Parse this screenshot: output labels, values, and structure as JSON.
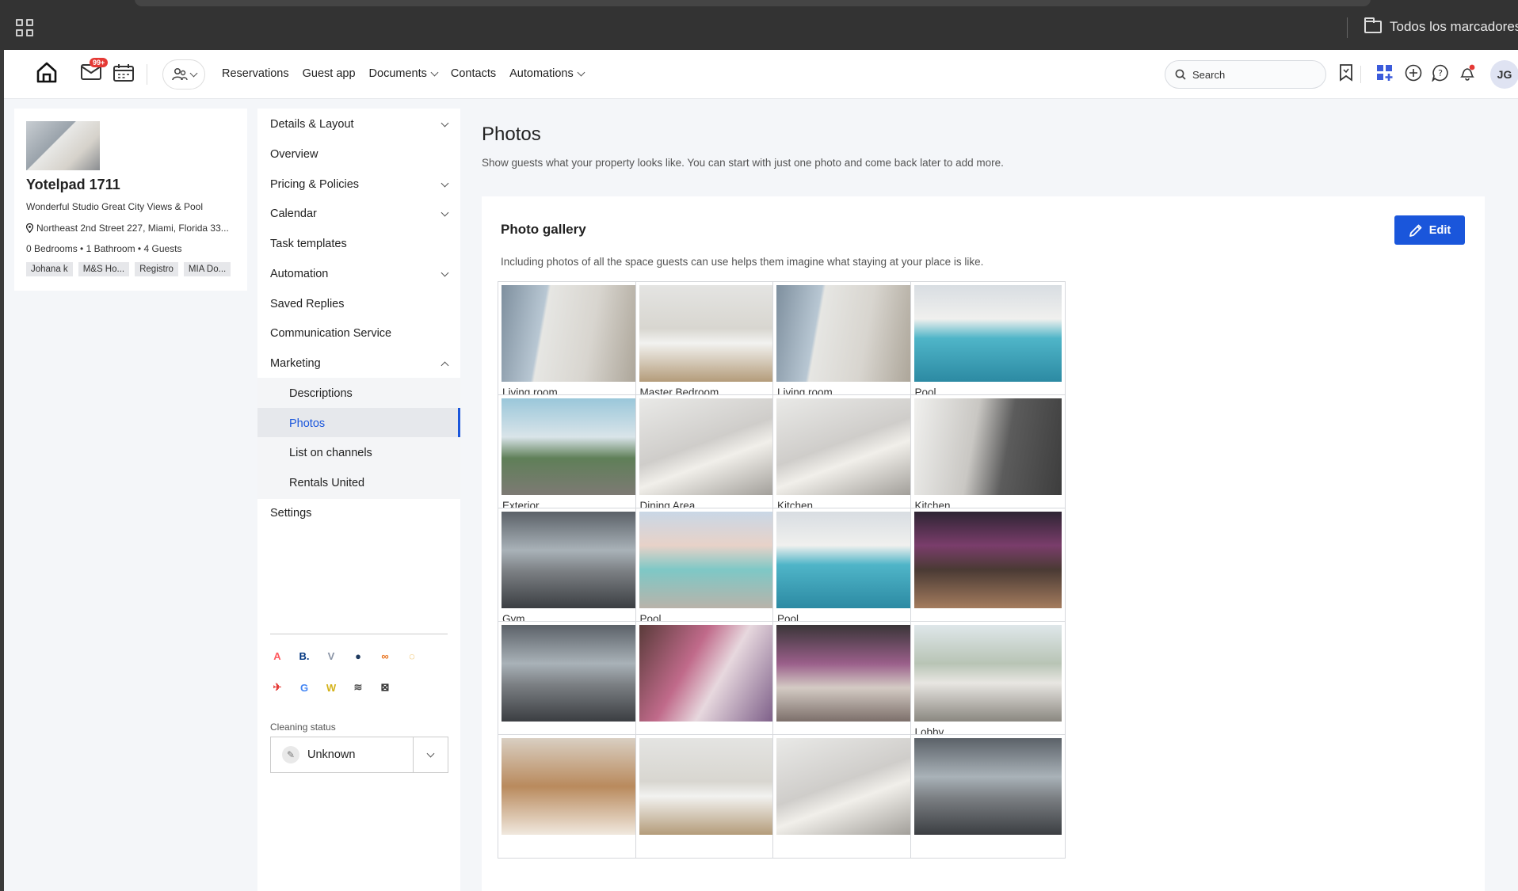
{
  "browser": {
    "bookmarks_label": "Todos los marcadores"
  },
  "topnav": {
    "mail_badge": "99+",
    "menu": [
      {
        "label": "Reservations",
        "dropdown": false
      },
      {
        "label": "Guest app",
        "dropdown": false
      },
      {
        "label": "Documents",
        "dropdown": true
      },
      {
        "label": "Contacts",
        "dropdown": false
      },
      {
        "label": "Automations",
        "dropdown": true
      }
    ],
    "search_placeholder": "Search",
    "avatar_initials": "JG"
  },
  "property": {
    "title": "Yotelpad 1711",
    "subtitle": "Wonderful Studio Great City Views & Pool",
    "address": "Northeast 2nd Street 227, Miami, Florida 33...",
    "meta": "0 Bedrooms  •  1 Bathroom  •  4 Guests",
    "tags": [
      "Johana k",
      "M&S Ho...",
      "Registro",
      "MIA Do..."
    ]
  },
  "subnav": {
    "items": [
      {
        "label": "Details & Layout",
        "chevron": "down"
      },
      {
        "label": "Overview",
        "chevron": ""
      },
      {
        "label": "Pricing & Policies",
        "chevron": "down"
      },
      {
        "label": "Calendar",
        "chevron": "down"
      },
      {
        "label": "Task templates",
        "chevron": ""
      },
      {
        "label": "Automation",
        "chevron": "down"
      },
      {
        "label": "Saved Replies",
        "chevron": ""
      },
      {
        "label": "Communication Service",
        "chevron": ""
      },
      {
        "label": "Marketing",
        "chevron": "up"
      },
      {
        "label": "Descriptions",
        "child": true
      },
      {
        "label": "Photos",
        "child": true,
        "active": true
      },
      {
        "label": "List on channels",
        "child": true
      },
      {
        "label": "Rentals United",
        "child": true
      },
      {
        "label": "Settings",
        "chevron": ""
      }
    ],
    "channels": [
      {
        "icon": "airbnb-icon",
        "glyph": "A",
        "color": "#ff5a5f"
      },
      {
        "icon": "booking-icon",
        "glyph": "B.",
        "color": "#003580"
      },
      {
        "icon": "vrbo-icon",
        "glyph": "V",
        "color": "#8a94a6"
      },
      {
        "icon": "expedia-icon",
        "glyph": "●",
        "color": "#1e3a5f"
      },
      {
        "icon": "channel-orange-icon",
        "glyph": "∞",
        "color": "#e8711a"
      },
      {
        "icon": "chat-channel-icon",
        "glyph": "◌",
        "color": "#e8a21a"
      },
      {
        "icon": "channel-red-icon",
        "glyph": "✈",
        "color": "#e53935"
      },
      {
        "icon": "google-icon",
        "glyph": "G",
        "color": "#4285f4"
      },
      {
        "icon": "channel-w-icon",
        "glyph": "W",
        "color": "#d4b21a"
      },
      {
        "icon": "channel-text-icon",
        "glyph": "≋",
        "color": "#555555"
      },
      {
        "icon": "channel-box-icon",
        "glyph": "⊠",
        "color": "#333333"
      }
    ],
    "cleaning_label": "Cleaning status",
    "cleaning_value": "Unknown"
  },
  "main": {
    "title": "Photos",
    "description": "Show guests what your property looks like. You can start with just one photo and come back later to add more.",
    "gallery": {
      "title": "Photo gallery",
      "description": "Including photos of all the space guests can use helps them imagine what staying at your place is like.",
      "edit_label": "Edit",
      "photos": [
        {
          "caption": "Living room",
          "tone": "a"
        },
        {
          "caption": "Master Bedroom",
          "tone": "b"
        },
        {
          "caption": "Living room",
          "tone": "a"
        },
        {
          "caption": "Pool",
          "tone": "c"
        },
        {
          "caption": "Exterior",
          "tone": "d"
        },
        {
          "caption": "Dining Area",
          "tone": "e"
        },
        {
          "caption": "Kitchen",
          "tone": "e"
        },
        {
          "caption": "Kitchen",
          "tone": "f"
        },
        {
          "caption": "Gym",
          "tone": "g"
        },
        {
          "caption": "Pool",
          "tone": "h"
        },
        {
          "caption": "Pool",
          "tone": "c"
        },
        {
          "caption": "",
          "tone": "i"
        },
        {
          "caption": "",
          "tone": "g"
        },
        {
          "caption": "",
          "tone": "j"
        },
        {
          "caption": "",
          "tone": "k"
        },
        {
          "caption": "Lobby",
          "tone": "l"
        },
        {
          "caption": "",
          "tone": "m"
        },
        {
          "caption": "",
          "tone": "b"
        },
        {
          "caption": "",
          "tone": "e"
        },
        {
          "caption": "",
          "tone": "g"
        }
      ]
    }
  }
}
